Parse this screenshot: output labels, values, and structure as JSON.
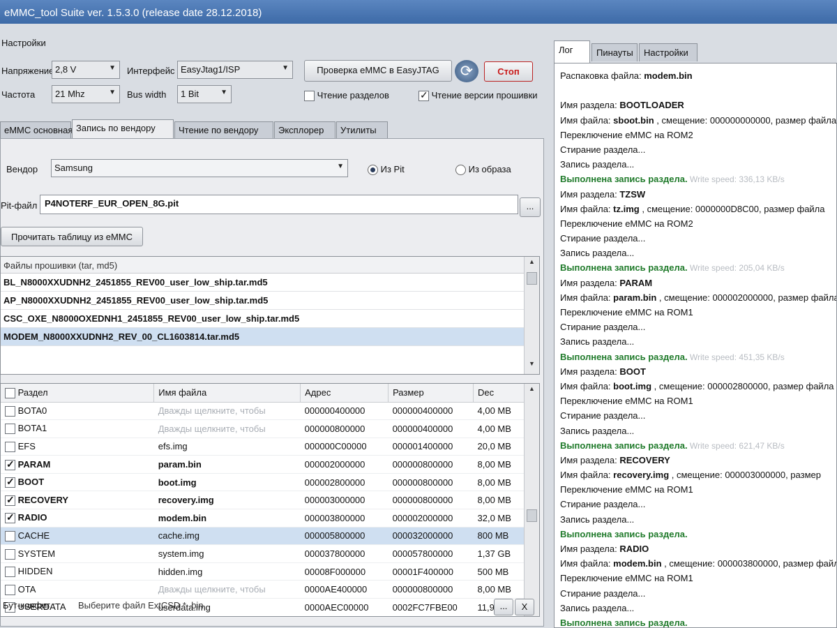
{
  "app": {
    "title": "eMMC_tool Suite  ver. 1.5.3.0 (release date 28.12.2018)"
  },
  "settings": {
    "section_label": "Настройки",
    "voltage_label": "Напряжение",
    "voltage_value": "2,8 V",
    "interface_label": "Интерфейс",
    "interface_value": "EasyJtag1/ISP",
    "check_button": "Проверка eMMC в EasyJTAG",
    "stop_button": "Стоп",
    "frequency_label": "Частота",
    "frequency_value": "21 Mhz",
    "bus_width_label": "Bus width",
    "bus_width_value": "1 Bit",
    "read_partitions_label": "Чтение разделов",
    "read_partitions_checked": false,
    "read_fw_version_label": "Чтение версии прошивки",
    "read_fw_version_checked": true
  },
  "tabs": [
    "eMMC основная",
    "Запись по вендору",
    "Чтение по вендору",
    "Эксплорер",
    "Утилиты"
  ],
  "vendor": {
    "vendor_label": "Вендор",
    "vendor_value": "Samsung",
    "radio_pit_label": "Из Pit",
    "radio_image_label": "Из образа",
    "pit_label": "Pit-файл",
    "pit_value": "P4NOTERF_EUR_OPEN_8G.pit",
    "browse_label": "...",
    "read_table_button": "Прочитать таблицу из eMMC"
  },
  "firmware_files": {
    "header": "Файлы прошивки (tar, md5)",
    "items": [
      "BL_N8000XXUDNH2_2451855_REV00_user_low_ship.tar.md5",
      "AP_N8000XXUDNH2_2451855_REV00_user_low_ship.tar.md5",
      "CSC_OXE_N8000OXEDNH1_2451855_REV00_user_low_ship.tar.md5",
      "MODEM_N8000XXUDNH2_REV_00_CL1603814.tar.md5"
    ]
  },
  "partitions": {
    "columns": [
      "Раздел",
      "Имя файла",
      "Адрес",
      "Размер",
      "Dec"
    ],
    "rows": [
      {
        "name": "BOTA0",
        "file": "Дважды щелкните, чтобы",
        "addr": "000000400000",
        "size": "000000400000",
        "dec": "4,00 MB"
      },
      {
        "name": "BOTA1",
        "file": "Дважды щелкните, чтобы",
        "addr": "000000800000",
        "size": "000000400000",
        "dec": "4,00 MB"
      },
      {
        "name": "EFS",
        "file": "efs.img",
        "addr": "000000C00000",
        "size": "000001400000",
        "dec": "20,0 MB"
      },
      {
        "name": "PARAM",
        "file": "param.bin",
        "addr": "000002000000",
        "size": "000000800000",
        "dec": "8,00 MB"
      },
      {
        "name": "BOOT",
        "file": "boot.img",
        "addr": "000002800000",
        "size": "000000800000",
        "dec": "8,00 MB"
      },
      {
        "name": "RECOVERY",
        "file": "recovery.img",
        "addr": "000003000000",
        "size": "000000800000",
        "dec": "8,00 MB"
      },
      {
        "name": "RADIO",
        "file": "modem.bin",
        "addr": "000003800000",
        "size": "000002000000",
        "dec": "32,0 MB"
      },
      {
        "name": "CACHE",
        "file": "cache.img",
        "addr": "000005800000",
        "size": "000032000000",
        "dec": "800 MB"
      },
      {
        "name": "SYSTEM",
        "file": "system.img",
        "addr": "000037800000",
        "size": "000057800000",
        "dec": "1,37 GB"
      },
      {
        "name": "HIDDEN",
        "file": "hidden.img",
        "addr": "00008F000000",
        "size": "00001F400000",
        "dec": "500 MB"
      },
      {
        "name": "OTA",
        "file": "Дважды щелкните, чтобы",
        "addr": "0000AE400000",
        "size": "000000800000",
        "dec": "8,00 MB"
      },
      {
        "name": "USERDATA",
        "file": "userdata.img",
        "addr": "0000AEC00000",
        "size": "0002FC7FBE00",
        "dec": "11,9 GB"
      }
    ]
  },
  "boot_config": {
    "label": "Бут-конфиг :",
    "value": "Выберите файл ExtCSD * .bin",
    "browse_label": "...",
    "clear_label": "X"
  },
  "right_tabs": [
    "Лог",
    "Пинауты",
    "Настройки"
  ],
  "log": {
    "lines": [
      {
        "t": "Распаковка файла: ",
        "v": "modem.bin"
      },
      {
        "t": "",
        "v": ""
      },
      {
        "t": "Имя раздела: ",
        "v": "BOOTLOADER"
      },
      {
        "t": "Имя файла: ",
        "v": "sboot.bin",
        "rest": " , смещение: 000000000000, размер файла"
      },
      {
        "t": "Переключение eMMC на ROM2"
      },
      {
        "t": "Стирание раздела..."
      },
      {
        "t": "Запись раздела..."
      },
      {
        "ok": "Выполнена запись раздела.",
        "speed": " Write speed: 336,13 KB/s"
      },
      {
        "t": "Имя раздела: ",
        "v": "TZSW"
      },
      {
        "t": "Имя файла: ",
        "v": "tz.img",
        "rest": " , смещение: 0000000D8C00, размер файла"
      },
      {
        "t": "Переключение eMMC на ROM2"
      },
      {
        "t": "Стирание раздела..."
      },
      {
        "t": "Запись раздела..."
      },
      {
        "ok": "Выполнена запись раздела.",
        "speed": " Write speed: 205,04 KB/s"
      },
      {
        "t": "Имя раздела: ",
        "v": "PARAM"
      },
      {
        "t": "Имя файла: ",
        "v": "param.bin",
        "rest": " , смещение: 000002000000, размер файла"
      },
      {
        "t": "Переключение eMMC на ROM1"
      },
      {
        "t": "Стирание раздела..."
      },
      {
        "t": "Запись раздела..."
      },
      {
        "ok": "Выполнена запись раздела.",
        "speed": " Write speed: 451,35 KB/s"
      },
      {
        "t": "Имя раздела: ",
        "v": "BOOT"
      },
      {
        "t": "Имя файла: ",
        "v": "boot.img",
        "rest": " , смещение: 000002800000, размер файла"
      },
      {
        "t": "Переключение eMMC на ROM1"
      },
      {
        "t": "Стирание раздела..."
      },
      {
        "t": "Запись раздела..."
      },
      {
        "ok": "Выполнена запись раздела.",
        "speed": " Write speed: 621,47 KB/s"
      },
      {
        "t": "Имя раздела: ",
        "v": "RECOVERY"
      },
      {
        "t": "Имя файла: ",
        "v": "recovery.img",
        "rest": " , смещение: 000003000000, размер"
      },
      {
        "t": "Переключение eMMC на ROM1"
      },
      {
        "t": "Стирание раздела..."
      },
      {
        "t": "Запись раздела..."
      },
      {
        "ok": "Выполнена запись раздела."
      },
      {
        "t": "Имя раздела: ",
        "v": "RADIO"
      },
      {
        "t": "Имя файла: ",
        "v": "modem.bin",
        "rest": " , смещение: 000003800000, размер файла"
      },
      {
        "t": "Переключение eMMC на ROM1"
      },
      {
        "t": "Стирание раздела..."
      },
      {
        "t": "Запись раздела..."
      },
      {
        "ok": "Выполнена запись раздела."
      }
    ]
  }
}
